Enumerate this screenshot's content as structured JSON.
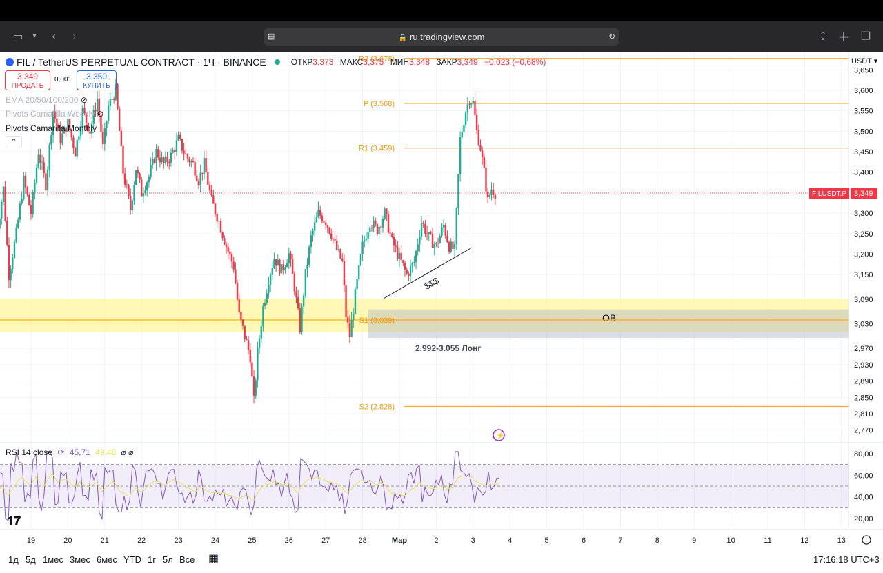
{
  "browser": {
    "url": "ru.tradingview.com",
    "icons": [
      "sidebar-icon",
      "chevron-down-icon",
      "back-icon",
      "forward-icon",
      "reader-icon",
      "lock-icon",
      "reload-icon",
      "share-icon",
      "new-tab-icon",
      "tabs-icon"
    ]
  },
  "legend": {
    "symbol": "FIL / TetherUS PERPETUAL CONTRACT · 1Ч · BINANCE",
    "o_label": "ОТКР",
    "o_value": "3,373",
    "h_label": "МАКС",
    "h_value": "3,375",
    "l_label": "МИН",
    "l_value": "3,348",
    "c_label": "ЗАКР",
    "c_value": "3,349",
    "change": "−0,023 (−0,68%)"
  },
  "trade": {
    "sell_price": "3,349",
    "sell_label": "ПРОДАТЬ",
    "spread": "0,001",
    "buy_price": "3,350",
    "buy_label": "КУПИТЬ"
  },
  "indicators": {
    "ema": "EMA 20/50/100/200",
    "weekly": "Pivots Camarilla Weekly",
    "monthly": "Pivots Camarilla Monthly"
  },
  "currency": "USDT",
  "chart_data": {
    "type": "candlestick",
    "price_scale": [
      "3,650",
      "3,600",
      "3,550",
      "3,500",
      "3,450",
      "3,400",
      "3,300",
      "3,250",
      "3,200",
      "3,150",
      "3,090",
      "3,030",
      "2,970",
      "2,930",
      "2,890",
      "2,850",
      "2,810",
      "2,770"
    ],
    "last_price": "3,349",
    "symbol_tag": "FILUSDT.P",
    "pivots": [
      {
        "label": "R2 (3.678)",
        "value": 3.678
      },
      {
        "label": "P (3.568)",
        "value": 3.568
      },
      {
        "label": "R1 (3.459)",
        "value": 3.459
      },
      {
        "label": "S1 (3.039)",
        "value": 3.039
      },
      {
        "label": "S2 (2.828)",
        "value": 2.828
      }
    ],
    "annotations": {
      "ob": "OB",
      "long": "2.992-3.055 Лонг",
      "liquidity": "$$$"
    },
    "zones": {
      "yellow": [
        3.01,
        3.09
      ],
      "ob": [
        2.995,
        3.065
      ]
    },
    "x_ticks": [
      "19",
      "20",
      "21",
      "22",
      "23",
      "24",
      "25",
      "26",
      "27",
      "28",
      "Мар",
      "2",
      "3",
      "4",
      "5",
      "6",
      "7",
      "8",
      "9",
      "10",
      "11",
      "12",
      "13"
    ],
    "ohlc_samples": [
      [
        18.0,
        3.4
      ],
      [
        18.1,
        3.27
      ],
      [
        18.25,
        3.36
      ],
      [
        18.4,
        3.15
      ],
      [
        18.6,
        3.25
      ],
      [
        18.8,
        3.38
      ],
      [
        19.0,
        3.3
      ],
      [
        19.2,
        3.45
      ],
      [
        19.4,
        3.37
      ],
      [
        19.6,
        3.55
      ],
      [
        19.8,
        3.48
      ],
      [
        20.0,
        3.52
      ],
      [
        20.2,
        3.45
      ],
      [
        20.4,
        3.55
      ],
      [
        20.6,
        3.5
      ],
      [
        20.8,
        3.58
      ],
      [
        20.95,
        3.46
      ],
      [
        21.1,
        3.56
      ],
      [
        21.3,
        3.6
      ],
      [
        21.4,
        3.5
      ],
      [
        21.5,
        3.4
      ],
      [
        21.7,
        3.31
      ],
      [
        21.85,
        3.41
      ],
      [
        22.0,
        3.35
      ],
      [
        22.2,
        3.39
      ],
      [
        22.4,
        3.45
      ],
      [
        22.6,
        3.42
      ],
      [
        22.8,
        3.44
      ],
      [
        23.0,
        3.48
      ],
      [
        23.2,
        3.44
      ],
      [
        23.4,
        3.42
      ],
      [
        23.55,
        3.38
      ],
      [
        23.7,
        3.42
      ],
      [
        23.9,
        3.33
      ],
      [
        24.1,
        3.28
      ],
      [
        24.3,
        3.22
      ],
      [
        24.5,
        3.17
      ],
      [
        24.65,
        3.05
      ],
      [
        24.8,
        3.0
      ],
      [
        24.95,
        2.95
      ],
      [
        25.05,
        2.84
      ],
      [
        25.15,
        2.96
      ],
      [
        25.3,
        3.07
      ],
      [
        25.45,
        3.14
      ],
      [
        25.6,
        3.19
      ],
      [
        25.8,
        3.16
      ],
      [
        26.0,
        3.2
      ],
      [
        26.15,
        3.12
      ],
      [
        26.3,
        3.02
      ],
      [
        26.45,
        3.15
      ],
      [
        26.6,
        3.24
      ],
      [
        26.8,
        3.3
      ],
      [
        27.0,
        3.28
      ],
      [
        27.15,
        3.25
      ],
      [
        27.3,
        3.21
      ],
      [
        27.45,
        3.18
      ],
      [
        27.55,
        3.05
      ],
      [
        27.65,
        3.0
      ],
      [
        27.8,
        3.1
      ],
      [
        28.0,
        3.22
      ],
      [
        28.2,
        3.28
      ],
      [
        28.4,
        3.26
      ],
      [
        28.6,
        3.3
      ],
      [
        28.8,
        3.23
      ],
      [
        29.0,
        3.19
      ],
      [
        29.2,
        3.15
      ],
      [
        29.4,
        3.18
      ],
      [
        29.6,
        3.28
      ],
      [
        29.8,
        3.24
      ],
      [
        30.0,
        3.22
      ],
      [
        30.2,
        3.27
      ],
      [
        30.35,
        3.22
      ],
      [
        30.5,
        3.21
      ],
      [
        30.65,
        3.48
      ],
      [
        30.8,
        3.55
      ],
      [
        30.9,
        3.58
      ],
      [
        31.0,
        3.57
      ],
      [
        31.1,
        3.5
      ],
      [
        31.2,
        3.46
      ],
      [
        31.3,
        3.4
      ],
      [
        31.4,
        3.33
      ],
      [
        31.5,
        3.36
      ],
      [
        31.6,
        3.35
      ]
    ],
    "rsi": {
      "label": "RSI 14 close",
      "value": "45,71",
      "ma_value": "49,48",
      "levels": [
        "80,00",
        "60,00",
        "40,00",
        "20,00"
      ]
    }
  },
  "bottom": {
    "ranges": [
      "1д",
      "5д",
      "1мес",
      "3мес",
      "6мес",
      "YTD",
      "1г",
      "5л",
      "Все"
    ],
    "time": "17:16:18 UTC+3"
  }
}
